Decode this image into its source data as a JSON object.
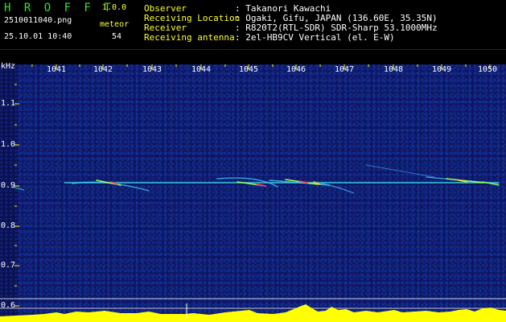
{
  "header": {
    "app_title": "H R O F F T",
    "app_version": "1.0.0",
    "file_name": "2510011040.png",
    "datetime": "25.10.01 10:40",
    "meteor_label": "meteor",
    "meteor_count": "54",
    "info": [
      {
        "key": "Observer",
        "value": ": Takanori Kawachi"
      },
      {
        "key": "Receiving Location",
        "value": ": Ogaki, Gifu, JAPAN (136.60E, 35.35N)"
      },
      {
        "key": "Receiver",
        "value": ": R820T2(RTL-SDR) SDR-Sharp 53.1000MHz"
      },
      {
        "key": "Receiving antenna",
        "value": ": 2el-HB9CV Vertical (el. E-W)"
      }
    ]
  },
  "spectrogram": {
    "y_unit": "kHz",
    "y_ticks": [
      "1.1",
      "1.0",
      "0.9",
      "0.8",
      "0.7",
      "0.6"
    ],
    "x_ticks": [
      "1041",
      "1042",
      "1043",
      "1044",
      "1045",
      "1046",
      "1047",
      "1048",
      "1049",
      "1050"
    ],
    "colors": {
      "background": "#0d1660",
      "trace": "#3dd8e0",
      "echo_hot": "#ff3366",
      "level": "#ffff00",
      "level_base": "#33ccff"
    }
  }
}
